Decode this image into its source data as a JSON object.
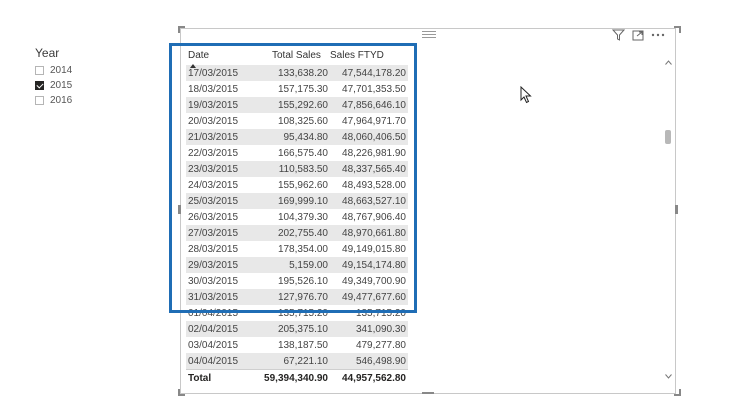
{
  "slicer": {
    "title": "Year",
    "items": [
      {
        "label": "2014",
        "checked": false
      },
      {
        "label": "2015",
        "checked": true
      },
      {
        "label": "2016",
        "checked": false
      }
    ]
  },
  "visual_header": {
    "icons": [
      "filter-icon",
      "focus-mode-icon",
      "more-options-icon"
    ]
  },
  "table": {
    "columns": [
      "Date",
      "Total Sales",
      "Sales FTYD"
    ],
    "sort_column": "Date",
    "rows": [
      [
        "17/03/2015",
        "133,638.20",
        "47,544,178.20"
      ],
      [
        "18/03/2015",
        "157,175.30",
        "47,701,353.50"
      ],
      [
        "19/03/2015",
        "155,292.60",
        "47,856,646.10"
      ],
      [
        "20/03/2015",
        "108,325.60",
        "47,964,971.70"
      ],
      [
        "21/03/2015",
        "95,434.80",
        "48,060,406.50"
      ],
      [
        "22/03/2015",
        "166,575.40",
        "48,226,981.90"
      ],
      [
        "23/03/2015",
        "110,583.50",
        "48,337,565.40"
      ],
      [
        "24/03/2015",
        "155,962.60",
        "48,493,528.00"
      ],
      [
        "25/03/2015",
        "169,999.10",
        "48,663,527.10"
      ],
      [
        "26/03/2015",
        "104,379.30",
        "48,767,906.40"
      ],
      [
        "27/03/2015",
        "202,755.40",
        "48,970,661.80"
      ],
      [
        "28/03/2015",
        "178,354.00",
        "49,149,015.80"
      ],
      [
        "29/03/2015",
        "5,159.00",
        "49,154,174.80"
      ],
      [
        "30/03/2015",
        "195,526.10",
        "49,349,700.90"
      ],
      [
        "31/03/2015",
        "127,976.70",
        "49,477,677.60"
      ],
      [
        "01/04/2015",
        "135,715.20",
        "135,715.20"
      ],
      [
        "02/04/2015",
        "205,375.10",
        "341,090.30"
      ],
      [
        "03/04/2015",
        "138,187.50",
        "479,277.80"
      ],
      [
        "04/04/2015",
        "67,221.10",
        "546,498.90"
      ]
    ],
    "totals": [
      "Total",
      "59,394,340.90",
      "44,957,562.80"
    ]
  },
  "colors": {
    "highlight_border": "#1f6db5",
    "alt_row": "#e8e8e8"
  }
}
